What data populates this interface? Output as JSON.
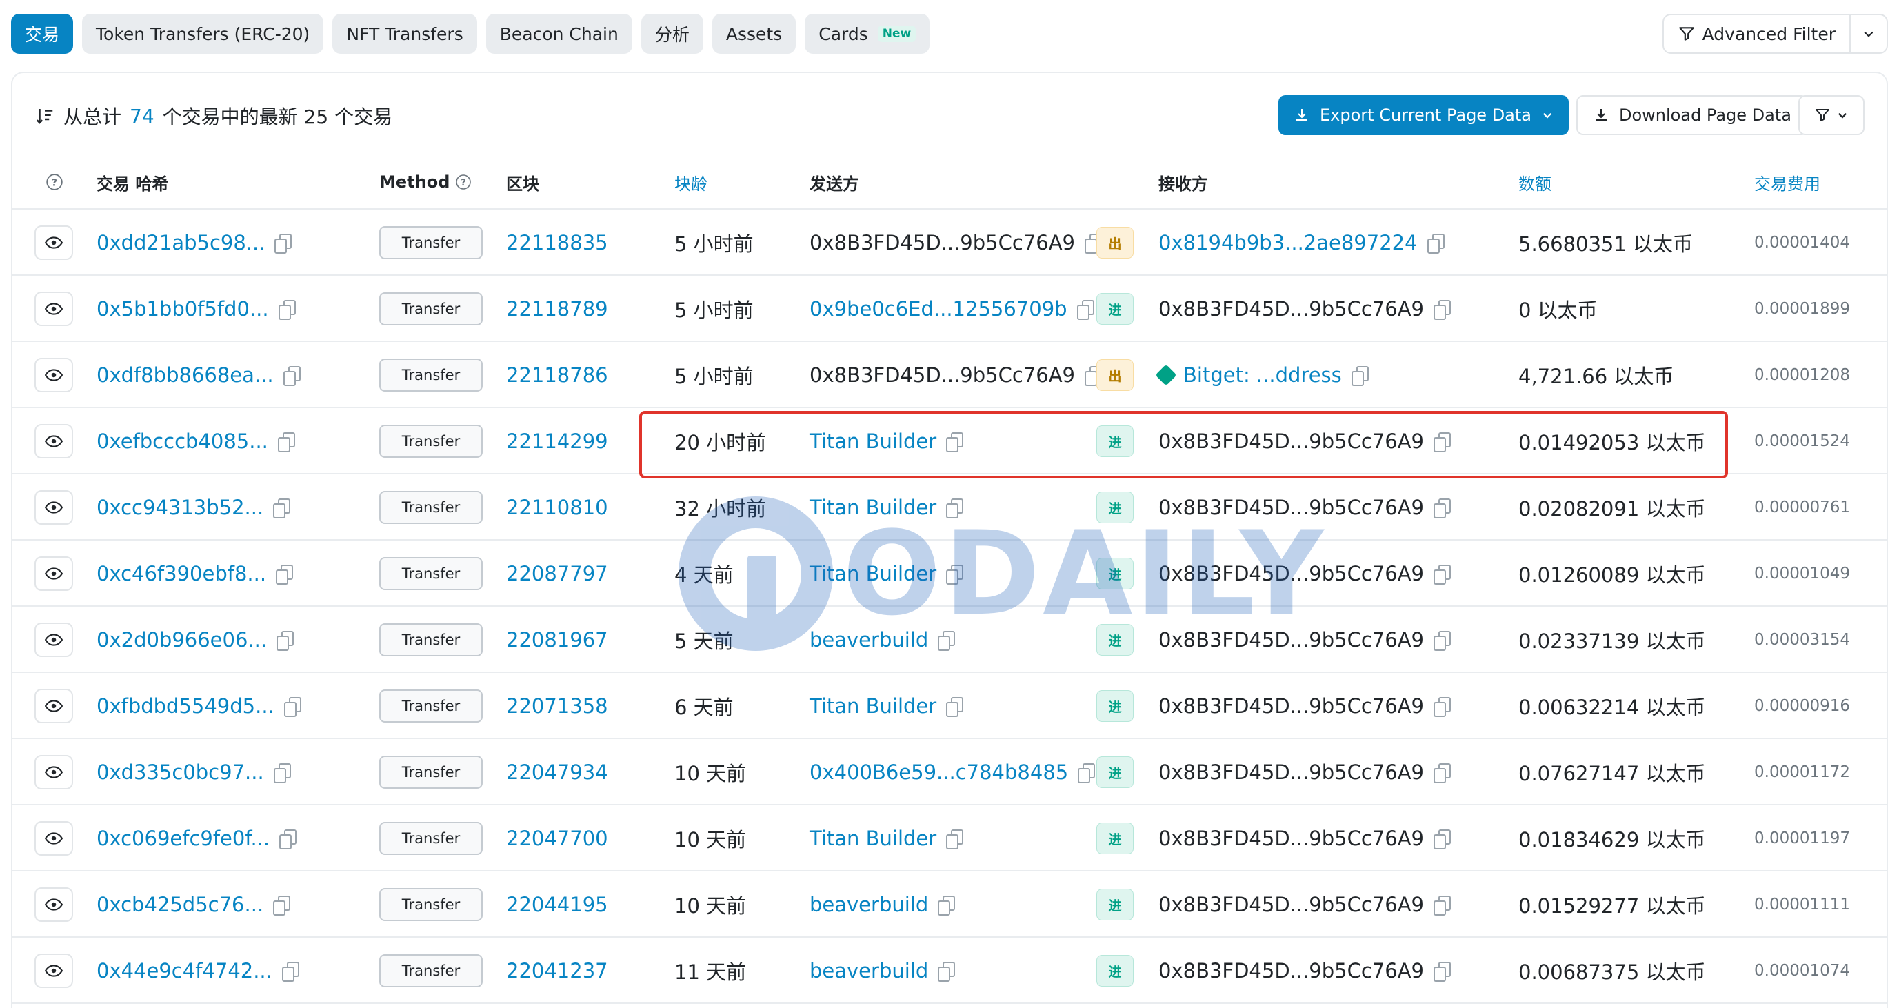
{
  "tabs": [
    {
      "label": "交易",
      "active": true
    },
    {
      "label": "Token Transfers (ERC-20)",
      "active": false
    },
    {
      "label": "NFT Transfers",
      "active": false
    },
    {
      "label": "Beacon Chain",
      "active": false
    },
    {
      "label": "分析",
      "active": false
    },
    {
      "label": "Assets",
      "active": false
    },
    {
      "label": "Cards",
      "active": false,
      "badge": "New"
    }
  ],
  "advanced_filter_label": "Advanced Filter",
  "summary": {
    "prefix": "从总计",
    "total": "74",
    "suffix": "个交易中的最新 25 个交易"
  },
  "buttons": {
    "export": "Export Current Page Data",
    "download": "Download Page Data"
  },
  "columns": {
    "help": "?",
    "hash": "交易 哈希",
    "method": "Method",
    "block": "区块",
    "age": "块龄",
    "from": "发送方",
    "to": "接收方",
    "value": "数额",
    "fee": "交易费用"
  },
  "colors": {
    "accent": "#0784c3",
    "out_badge": "#fdf1d9",
    "in_badge": "#dff5ef",
    "highlight": "#e0342b"
  },
  "rows": [
    {
      "hash": "0xdd21ab5c98...",
      "method": "Transfer",
      "block": "22118835",
      "age": "5 小时前",
      "from": "0x8B3FD45D...9b5Cc76A9",
      "from_link": false,
      "dir": "出",
      "dir_type": "out",
      "to": "0x8194b9b3...2ae897224",
      "to_link": true,
      "value": "5.6680351 以太币",
      "fee": "0.00001404"
    },
    {
      "hash": "0x5b1bb0f5fd0...",
      "method": "Transfer",
      "block": "22118789",
      "age": "5 小时前",
      "from": "0x9be0c6Ed...12556709b",
      "from_link": true,
      "dir": "进",
      "dir_type": "in",
      "to": "0x8B3FD45D...9b5Cc76A9",
      "to_link": false,
      "value": "0 以太币",
      "fee": "0.00001899"
    },
    {
      "hash": "0xdf8bb8668ea...",
      "method": "Transfer",
      "block": "22118786",
      "age": "5 小时前",
      "from": "0x8B3FD45D...9b5Cc76A9",
      "from_link": false,
      "dir": "出",
      "dir_type": "out",
      "to": "Bitget: ...ddress",
      "to_link": true,
      "to_icon": "bitget-icon",
      "value": "4,721.66 以太币",
      "fee": "0.00001208"
    },
    {
      "hash": "0xefbcccb4085...",
      "method": "Transfer",
      "block": "22114299",
      "age": "20 小时前",
      "from": "Titan Builder",
      "from_link": true,
      "dir": "进",
      "dir_type": "in",
      "to": "0x8B3FD45D...9b5Cc76A9",
      "to_link": false,
      "value": "0.01492053 以太币",
      "fee": "0.00001524"
    },
    {
      "hash": "0xcc94313b52...",
      "method": "Transfer",
      "block": "22110810",
      "age": "32 小时前",
      "from": "Titan Builder",
      "from_link": true,
      "dir": "进",
      "dir_type": "in",
      "to": "0x8B3FD45D...9b5Cc76A9",
      "to_link": false,
      "value": "0.02082091 以太币",
      "fee": "0.00000761"
    },
    {
      "hash": "0xc46f390ebf8...",
      "method": "Transfer",
      "block": "22087797",
      "age": "4 天前",
      "from": "Titan Builder",
      "from_link": true,
      "dir": "进",
      "dir_type": "in",
      "to": "0x8B3FD45D...9b5Cc76A9",
      "to_link": false,
      "value": "0.01260089 以太币",
      "fee": "0.00001049"
    },
    {
      "hash": "0x2d0b966e06...",
      "method": "Transfer",
      "block": "22081967",
      "age": "5 天前",
      "from": "beaverbuild",
      "from_link": true,
      "dir": "进",
      "dir_type": "in",
      "to": "0x8B3FD45D...9b5Cc76A9",
      "to_link": false,
      "value": "0.02337139 以太币",
      "fee": "0.00003154"
    },
    {
      "hash": "0xfbdbd5549d5...",
      "method": "Transfer",
      "block": "22071358",
      "age": "6 天前",
      "from": "Titan Builder",
      "from_link": true,
      "dir": "进",
      "dir_type": "in",
      "to": "0x8B3FD45D...9b5Cc76A9",
      "to_link": false,
      "value": "0.00632214 以太币",
      "fee": "0.00000916"
    },
    {
      "hash": "0xd335c0bc97...",
      "method": "Transfer",
      "block": "22047934",
      "age": "10 天前",
      "from": "0x400B6e59...c784b8485",
      "from_link": true,
      "dir": "进",
      "dir_type": "in",
      "to": "0x8B3FD45D...9b5Cc76A9",
      "to_link": false,
      "value": "0.07627147 以太币",
      "fee": "0.00001172"
    },
    {
      "hash": "0xc069efc9fe0f...",
      "method": "Transfer",
      "block": "22047700",
      "age": "10 天前",
      "from": "Titan Builder",
      "from_link": true,
      "dir": "进",
      "dir_type": "in",
      "to": "0x8B3FD45D...9b5Cc76A9",
      "to_link": false,
      "value": "0.01834629 以太币",
      "fee": "0.00001197"
    },
    {
      "hash": "0xcb425d5c76...",
      "method": "Transfer",
      "block": "22044195",
      "age": "10 天前",
      "from": "beaverbuild",
      "from_link": true,
      "dir": "进",
      "dir_type": "in",
      "to": "0x8B3FD45D...9b5Cc76A9",
      "to_link": false,
      "value": "0.01529277 以太币",
      "fee": "0.00001111"
    },
    {
      "hash": "0x44e9c4f4742...",
      "method": "Transfer",
      "block": "22041237",
      "age": "11 天前",
      "from": "beaverbuild",
      "from_link": true,
      "dir": "进",
      "dir_type": "in",
      "to": "0x8B3FD45D...9b5Cc76A9",
      "to_link": false,
      "value": "0.00687375 以太币",
      "fee": "0.00001074"
    }
  ],
  "watermark": "ODAILY"
}
